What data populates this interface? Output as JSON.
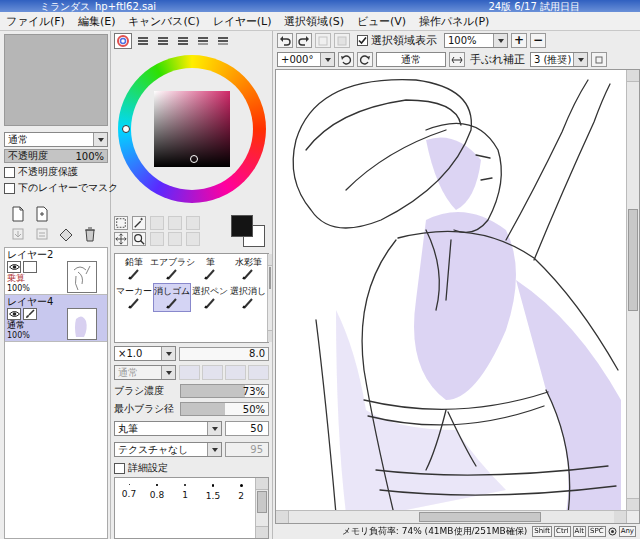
{
  "window": {
    "title": "ミランダス_hp+ftl62.sai",
    "trial": "24版 6/17 試用日目"
  },
  "menu": [
    "ファイル(F)",
    "編集(E)",
    "キャンバス(C)",
    "レイヤー(L)",
    "選択領域(S)",
    "ビュー(V)",
    "操作パネル(P)"
  ],
  "layer_panel": {
    "blend_mode": "通常",
    "opacity": {
      "label": "不透明度",
      "reading": "100%",
      "level": 1
    },
    "options": [
      {
        "label": "不透明度保護",
        "checked": false
      },
      {
        "label": "下のレイヤーでマスク",
        "checked": false
      }
    ],
    "layers": [
      {
        "name": "レイヤー2",
        "mode": "乗算",
        "opacity": "100%",
        "visible": true,
        "selected": false,
        "color": "#b03030"
      },
      {
        "name": "レイヤー4",
        "mode": "通常",
        "opacity": "100%",
        "visible": true,
        "selected": true,
        "color": "#000000"
      }
    ]
  },
  "color_panel": {
    "modes": [
      {
        "selected": true
      },
      {
        "selected": false
      },
      {
        "selected": false
      },
      {
        "selected": false
      },
      {
        "selected": false
      },
      {
        "selected": false
      }
    ],
    "foreground": "#141414",
    "background": "#ffffff"
  },
  "tools": [
    {
      "label": "鉛筆",
      "selected": false
    },
    {
      "label": "エアブラシ",
      "selected": false
    },
    {
      "label": "筆",
      "selected": false
    },
    {
      "label": "水彩筆",
      "selected": false
    },
    {
      "label": "マーカー",
      "selected": false
    },
    {
      "label": "消しゴム",
      "selected": true
    },
    {
      "label": "選択ペン",
      "selected": false
    },
    {
      "label": "選択消し",
      "selected": false
    }
  ],
  "brush": {
    "scale": "×1.0",
    "size": "8.0",
    "blend": "通常",
    "blend_disabled": true,
    "sliders": [
      {
        "label": "ブラシ濃度",
        "reading": "73%",
        "level": 0.73
      },
      {
        "label": "最小ブラシ径",
        "reading": "50%",
        "level": 0.5
      }
    ],
    "shape": {
      "value": "丸筆",
      "amount": "50",
      "disabled": false
    },
    "texture": {
      "value": "テクスチャなし",
      "amount": "95",
      "disabled": true
    },
    "advanced": {
      "label": "詳細設定",
      "checked": false
    },
    "sizes": [
      "0.7",
      "0.8",
      "1",
      "1.5",
      "2"
    ]
  },
  "canvas_toolbar": {
    "show_selection": {
      "label": "選択領域表示",
      "checked": true
    },
    "zoom": "100%",
    "zoom_in": "+",
    "zoom_out": "−",
    "rotation": "+000°",
    "blend": "通常",
    "stabilizer_label": "手ぶれ補正",
    "stabilizer": "3 (推奨)"
  },
  "status_bar": {
    "memory": "メモリ負荷率: 74% (41MB使用/251MB確保)",
    "keys": [
      {
        "label": "Shift",
        "on": false
      },
      {
        "label": "Ctrl",
        "on": false
      },
      {
        "label": "Alt",
        "on": false
      },
      {
        "label": "SPC",
        "on": false
      },
      {
        "label": "Any",
        "on": false
      }
    ]
  }
}
